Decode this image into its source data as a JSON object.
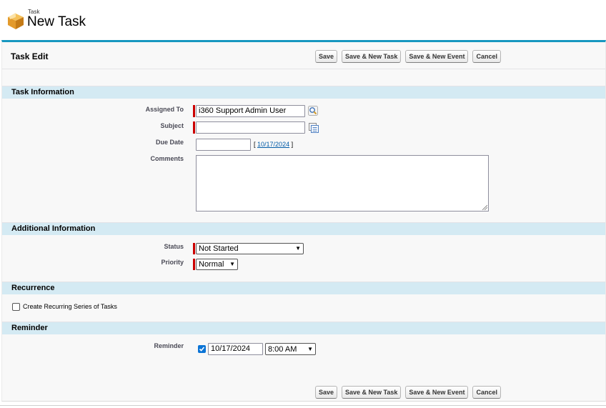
{
  "header": {
    "type_label": "Task",
    "title": "New Task"
  },
  "block": {
    "title": "Task Edit"
  },
  "buttons": {
    "save": "Save",
    "save_new_task": "Save & New Task",
    "save_new_event": "Save & New Event",
    "cancel": "Cancel"
  },
  "sections": {
    "task_info": "Task Information",
    "additional_info": "Additional Information",
    "recurrence": "Recurrence",
    "reminder": "Reminder"
  },
  "fields": {
    "assigned_to": {
      "label": "Assigned To",
      "value": "i360 Support Admin User"
    },
    "subject": {
      "label": "Subject",
      "value": ""
    },
    "due_date": {
      "label": "Due Date",
      "value": "",
      "today_prefix": "[",
      "today_link": "10/17/2024",
      "today_suffix": "]"
    },
    "comments": {
      "label": "Comments",
      "value": ""
    },
    "status": {
      "label": "Status",
      "value": "Not Started"
    },
    "priority": {
      "label": "Priority",
      "value": "Normal"
    },
    "recurrence": {
      "label": "Create Recurring Series of Tasks",
      "checked": false
    },
    "reminder": {
      "label": "Reminder",
      "checked": true,
      "date": "10/17/2024",
      "time": "8:00 AM"
    }
  },
  "colors": {
    "accent_border": "#1797c0",
    "section_bg": "#d4eaf3",
    "required": "#cc0000",
    "link": "#015ba7"
  },
  "icons": {
    "header": "task-box-icon",
    "assigned_lookup": "lookup-magnifier-icon",
    "subject_combo": "combobox-icon"
  }
}
